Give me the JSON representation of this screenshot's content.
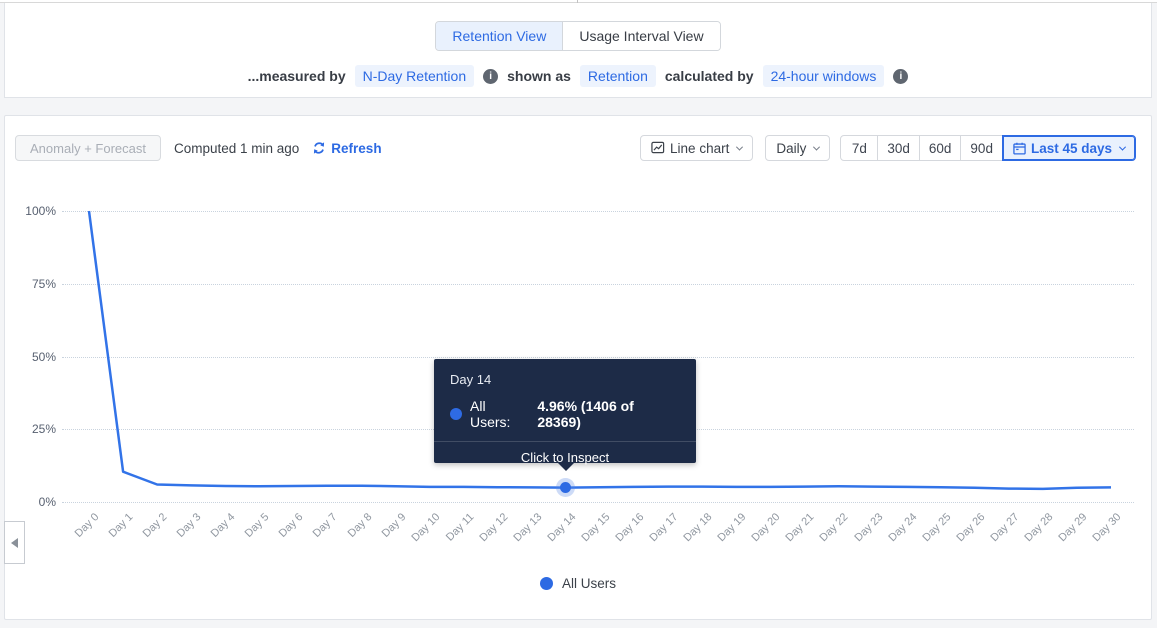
{
  "view_tabs": {
    "retention": "Retention View",
    "usage_interval": "Usage Interval View"
  },
  "measured_by": {
    "prefix": "...measured by",
    "metric_pill": "N-Day Retention",
    "shown_as_label": "shown as",
    "shown_as_pill": "Retention",
    "calculated_by_label": "calculated by",
    "calculated_by_pill": "24-hour windows"
  },
  "toolbar": {
    "anomaly_forecast_label": "Anomaly + Forecast",
    "computed_text": "Computed 1 min ago",
    "refresh_label": "Refresh",
    "chart_type_label": "Line chart",
    "interval_label": "Daily",
    "ranges": [
      "7d",
      "30d",
      "60d",
      "90d"
    ],
    "selected_range_label": "Last 45 days"
  },
  "tooltip": {
    "title": "Day 14",
    "series_label": "All Users:",
    "value": "4.96% (1406 of 28369)",
    "action": "Click to Inspect"
  },
  "legend": {
    "label": "All Users"
  },
  "colors": {
    "accent": "#2d6ae3",
    "line": "#3273e8",
    "pill_bg": "#edf3fd",
    "tooltip_bg": "#1d2b47",
    "grid": "#c9d3de",
    "axis_label": "#9097a0"
  },
  "chart_data": {
    "type": "line",
    "x": [
      "Day 0",
      "Day 1",
      "Day 2",
      "Day 3",
      "Day 4",
      "Day 5",
      "Day 6",
      "Day 7",
      "Day 8",
      "Day 9",
      "Day 10",
      "Day 11",
      "Day 12",
      "Day 13",
      "Day 14",
      "Day 15",
      "Day 16",
      "Day 17",
      "Day 18",
      "Day 19",
      "Day 20",
      "Day 21",
      "Day 22",
      "Day 23",
      "Day 24",
      "Day 25",
      "Day 26",
      "Day 27",
      "Day 28",
      "Day 29",
      "Day 30"
    ],
    "series": [
      {
        "name": "All Users",
        "values": [
          100,
          10.4,
          6.0,
          5.7,
          5.5,
          5.4,
          5.5,
          5.6,
          5.6,
          5.4,
          5.2,
          5.2,
          5.1,
          5.0,
          4.96,
          5.1,
          5.2,
          5.3,
          5.3,
          5.2,
          5.2,
          5.3,
          5.4,
          5.3,
          5.2,
          5.1,
          4.9,
          4.6,
          4.5,
          4.9,
          5.0
        ]
      }
    ],
    "ylim": [
      0,
      100
    ],
    "yticks": [
      {
        "value": 100,
        "label": "100%"
      },
      {
        "value": 75,
        "label": "75%"
      },
      {
        "value": 50,
        "label": "50%"
      },
      {
        "value": 25,
        "label": "25%"
      },
      {
        "value": 0,
        "label": "0%"
      }
    ],
    "grid": "horizontal-dotted",
    "legend_position": "bottom",
    "highlight": {
      "x": "Day 14",
      "index": 14,
      "series": "All Users",
      "value_pct": 4.96,
      "numerator": 1406,
      "denominator": 28369
    }
  }
}
